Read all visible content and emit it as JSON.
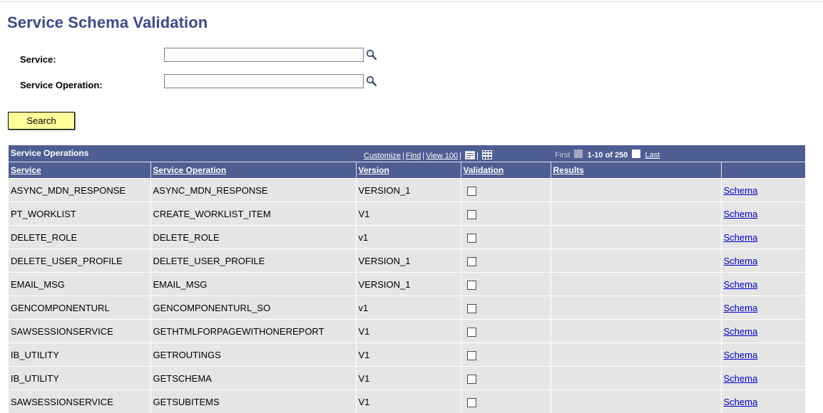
{
  "page": {
    "title": "Service Schema Validation"
  },
  "search_form": {
    "service_label": "Service:",
    "service_value": "",
    "operation_label": "Service Operation:",
    "operation_value": "",
    "search_button": "Search"
  },
  "grid": {
    "title": "Service Operations",
    "tools": {
      "customize": "Customize",
      "find": "Find",
      "view": "View 100"
    },
    "nav": {
      "first": "First",
      "range": "1-10 of 250",
      "last": "Last"
    },
    "columns": [
      "Service",
      "Service Operation",
      "Version",
      "Validation",
      "Results",
      ""
    ],
    "link_label": "Schema",
    "rows": [
      {
        "service": "ASYNC_MDN_RESPONSE",
        "operation": "ASYNC_MDN_RESPONSE",
        "version": "VERSION_1",
        "validation": false
      },
      {
        "service": "PT_WORKLIST",
        "operation": "CREATE_WORKLIST_ITEM",
        "version": "V1",
        "validation": false
      },
      {
        "service": "DELETE_ROLE",
        "operation": "DELETE_ROLE",
        "version": "v1",
        "validation": false
      },
      {
        "service": "DELETE_USER_PROFILE",
        "operation": "DELETE_USER_PROFILE",
        "version": "VERSION_1",
        "validation": false
      },
      {
        "service": "EMAIL_MSG",
        "operation": "EMAIL_MSG",
        "version": "VERSION_1",
        "validation": false
      },
      {
        "service": "GENCOMPONENTURL",
        "operation": "GENCOMPONENTURL_SO",
        "version": "v1",
        "validation": false
      },
      {
        "service": "SAWSESSIONSERVICE",
        "operation": "GETHTMLFORPAGEWITHONEREPORT",
        "version": "V1",
        "validation": false
      },
      {
        "service": "IB_UTILITY",
        "operation": "GETROUTINGS",
        "version": "V1",
        "validation": false
      },
      {
        "service": "IB_UTILITY",
        "operation": "GETSCHEMA",
        "version": "V1",
        "validation": false
      },
      {
        "service": "SAWSESSIONSERVICE",
        "operation": "GETSUBITEMS",
        "version": "V1",
        "validation": false
      }
    ]
  },
  "colors": {
    "header": "#4e5d92",
    "title": "#3b4a8c",
    "row": "#e5e5e5",
    "button": "#ffff99",
    "link": "#0000cc"
  },
  "icons": {
    "lookup": "magnifier-icon",
    "download": "download-icon",
    "chart": "grid-chart-icon",
    "first": "previous-arrow-icon",
    "last": "next-arrow-icon"
  }
}
